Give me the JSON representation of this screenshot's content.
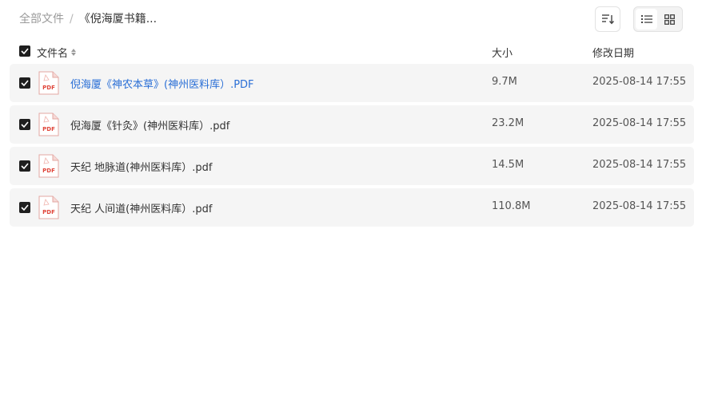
{
  "breadcrumb": {
    "root": "全部文件",
    "separator": "/",
    "current": "《倪海厦书籍..."
  },
  "toolbar": {
    "sort_icon": "sort-lines-icon",
    "views": [
      {
        "icon": "list-view-icon",
        "active": true
      },
      {
        "icon": "grid-view-icon",
        "active": false
      }
    ]
  },
  "table": {
    "headers": {
      "name": "文件名",
      "size": "大小",
      "date": "修改日期"
    },
    "rows": [
      {
        "name": "倪海厦《神农本草》(神州医料库）.PDF",
        "size": "9.7M",
        "date": "2025-08-14 17:55",
        "icon": "pdf-icon",
        "checked": true,
        "highlight": true
      },
      {
        "name": "倪海厦《针灸》(神州医料库）.pdf",
        "size": "23.2M",
        "date": "2025-08-14 17:55",
        "icon": "pdf-icon",
        "checked": true,
        "highlight": false
      },
      {
        "name": "天纪 地脉道(神州医料库）.pdf",
        "size": "14.5M",
        "date": "2025-08-14 17:55",
        "icon": "pdf-icon",
        "checked": true,
        "highlight": false
      },
      {
        "name": "天纪 人间道(神州医料库）.pdf",
        "size": "110.8M",
        "date": "2025-08-14 17:55",
        "icon": "pdf-icon",
        "checked": true,
        "highlight": false
      }
    ]
  },
  "colors": {
    "link": "#2a6fd6",
    "row_bg": "#f5f5f5",
    "pdf_red": "#e0463b",
    "checkbox": "#1f1f1f"
  },
  "pdf_icon_label": "PDF"
}
